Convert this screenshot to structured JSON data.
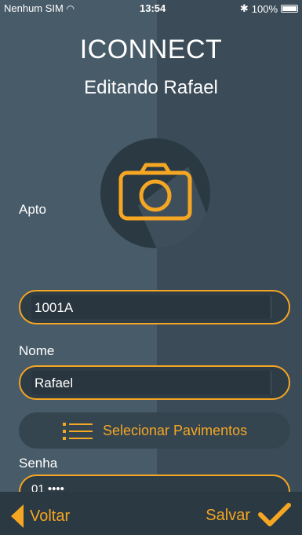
{
  "status_bar": {
    "carrier": "Nenhum SIM",
    "time": "13:54",
    "battery": "100%"
  },
  "header": {
    "title": "ICONNECT",
    "subtitle": "Editando Rafael"
  },
  "photo": {
    "icon": "camera-icon"
  },
  "form": {
    "apto_label": "Apto",
    "apto_value": "1001A",
    "nome_label": "Nome",
    "nome_value": "Rafael",
    "select_label": "Selecionar Pavimentos",
    "senha_label": "Senha",
    "senha_value": "01 ••••"
  },
  "footer": {
    "back_label": "Voltar",
    "save_label": "Salvar"
  },
  "colors": {
    "accent": "#f5a623",
    "background_left": "#485b69",
    "background_right": "#3b4b57"
  }
}
